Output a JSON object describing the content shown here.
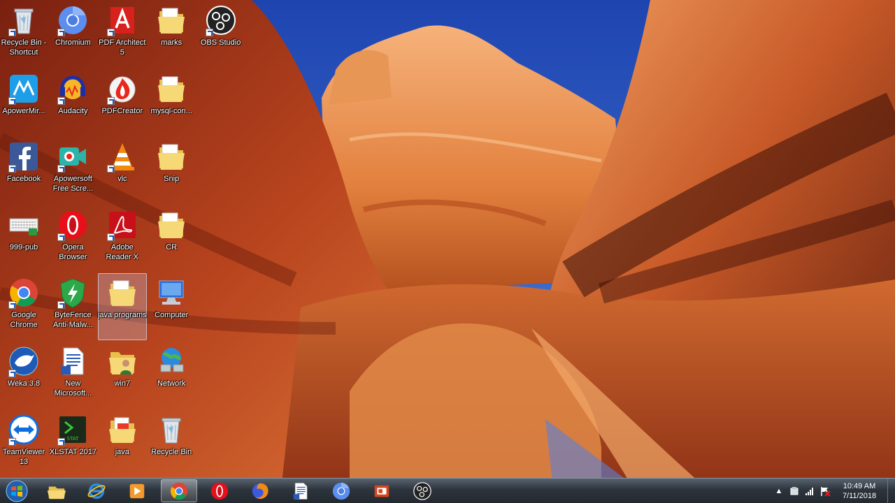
{
  "desktop": {
    "icons": [
      {
        "label": "Recycle Bin - Shortcut",
        "icon": "recycle-bin-icon",
        "shortcut": true
      },
      {
        "label": "Chromium",
        "icon": "chromium-icon",
        "shortcut": true
      },
      {
        "label": "PDF Architect 5",
        "icon": "pdf-architect-icon",
        "shortcut": true
      },
      {
        "label": "marks",
        "icon": "folder-icon",
        "shortcut": false
      },
      {
        "label": "OBS Studio",
        "icon": "obs-icon",
        "shortcut": true
      },
      {
        "label": "ApowerMir...",
        "icon": "apowermirror-icon",
        "shortcut": true
      },
      {
        "label": "Audacity",
        "icon": "audacity-icon",
        "shortcut": true
      },
      {
        "label": "PDFCreator",
        "icon": "pdfcreator-icon",
        "shortcut": true
      },
      {
        "label": "mysql-con...",
        "icon": "folder-icon",
        "shortcut": false
      },
      {
        "label": "Facebook",
        "icon": "facebook-icon",
        "shortcut": true
      },
      {
        "label": "Apowersoft Free Scre...",
        "icon": "apowersoft-recorder-icon",
        "shortcut": true
      },
      {
        "label": "vlc",
        "icon": "vlc-icon",
        "shortcut": true
      },
      {
        "label": "Snip",
        "icon": "folder-icon",
        "shortcut": false
      },
      {
        "label": "999-pub",
        "icon": "keyboard-file-icon",
        "shortcut": false
      },
      {
        "label": "Opera Browser",
        "icon": "opera-icon",
        "shortcut": true
      },
      {
        "label": "Adobe Reader X",
        "icon": "adobe-reader-icon",
        "shortcut": true
      },
      {
        "label": "CR",
        "icon": "folder-icon",
        "shortcut": false
      },
      {
        "label": "Google Chrome",
        "icon": "chrome-icon",
        "shortcut": true
      },
      {
        "label": "ByteFence Anti-Malw...",
        "icon": "bytefence-icon",
        "shortcut": true
      },
      {
        "label": "java programs",
        "icon": "folder-icon",
        "shortcut": false,
        "selected": true
      },
      {
        "label": "Computer",
        "icon": "computer-icon",
        "shortcut": false
      },
      {
        "label": "Weka 3.8",
        "icon": "weka-icon",
        "shortcut": true
      },
      {
        "label": "New Microsoft...",
        "icon": "document-icon",
        "shortcut": false
      },
      {
        "label": "win7",
        "icon": "folder-person-icon",
        "shortcut": false
      },
      {
        "label": "Network",
        "icon": "network-icon",
        "shortcut": false
      },
      {
        "label": "TeamViewer 13",
        "icon": "teamviewer-icon",
        "shortcut": true
      },
      {
        "label": "XLSTAT 2017",
        "icon": "xlstat-icon",
        "shortcut": true
      },
      {
        "label": "java",
        "icon": "folder-files-icon",
        "shortcut": false
      },
      {
        "label": "Recycle Bin",
        "icon": "recycle-bin-icon",
        "shortcut": false
      }
    ]
  },
  "taskbar": {
    "start_icon": "windows-start-icon",
    "pinned": [
      {
        "icon": "file-explorer-icon",
        "active": false
      },
      {
        "icon": "internet-explorer-icon",
        "active": false
      },
      {
        "icon": "media-player-icon",
        "active": false
      },
      {
        "icon": "chrome-icon",
        "active": true
      },
      {
        "icon": "opera-icon",
        "active": false
      },
      {
        "icon": "firefox-icon",
        "active": false
      },
      {
        "icon": "document-icon",
        "active": false
      },
      {
        "icon": "chromium-icon",
        "active": false
      },
      {
        "icon": "powerpoint-icon",
        "active": false
      },
      {
        "icon": "obs-icon",
        "active": false
      }
    ],
    "tray": {
      "icons": [
        "show-hidden-icons-arrow",
        "device-icon",
        "signal-icon",
        "flag-icon"
      ],
      "time": "10:49 AM",
      "date": "7/11/2018"
    }
  },
  "colors": {
    "sky": "#1f4fb8",
    "rock_light": "#f2a060",
    "rock_dark": "#5a1a0c",
    "taskbar": "#2d343d"
  }
}
